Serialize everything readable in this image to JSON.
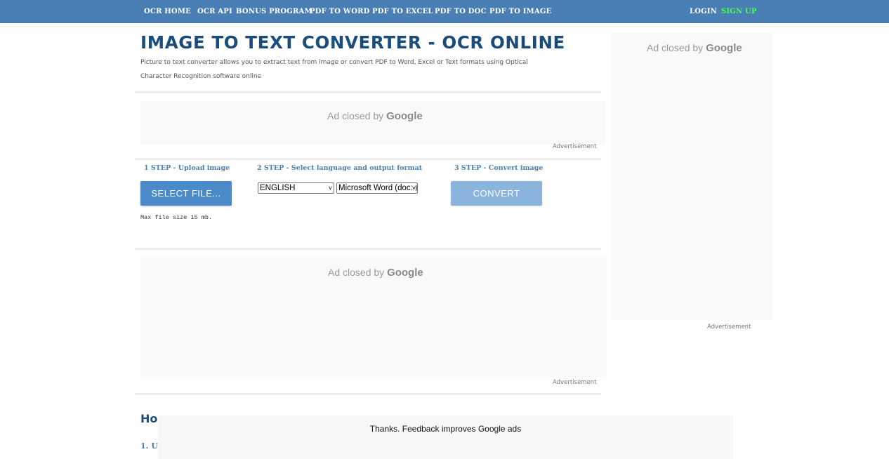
{
  "nav": {
    "items": [
      "OCR HOME",
      "OCR API",
      "BONUS PROGRAM",
      "PDF TO WORD",
      "PDF TO EXCEL",
      "PDF TO DOC",
      "PDF TO IMAGE"
    ],
    "login": "LOGIN",
    "signup": "SIGN UP"
  },
  "header": {
    "title": "IMAGE TO TEXT CONVERTER - OCR ONLINE",
    "description": "Picture to text converter allows you to extract text from image or convert PDF to Word, Excel or Text formats using Optical Character Recognition software online"
  },
  "ads": {
    "closed_prefix": "Ad closed by ",
    "closed_brand": "Google",
    "label": "Advertisement"
  },
  "steps": {
    "step1_title": "1 STEP - Upload image",
    "step2_title": "2 STEP - Select language and output format",
    "step3_title": "3 STEP - Convert image",
    "select_file_button": "SELECT FILE...",
    "language_selected": "ENGLISH",
    "format_selected": "Microsoft Word (docx)",
    "convert_button": "CONVERT",
    "max_file_size": "Max file size 15 mb."
  },
  "bottom": {
    "how_heading_visible": "Ho",
    "how_step_visible": "1. U",
    "feedback": "Thanks. Feedback improves Google ads"
  },
  "colors": {
    "nav_bg": "#4a7fb5",
    "title": "#1a4d7c",
    "accent": "#4a7fb5",
    "signup": "#4cff4c",
    "button_primary": "#4a8ac8",
    "button_disabled": "#8ab4dc"
  }
}
